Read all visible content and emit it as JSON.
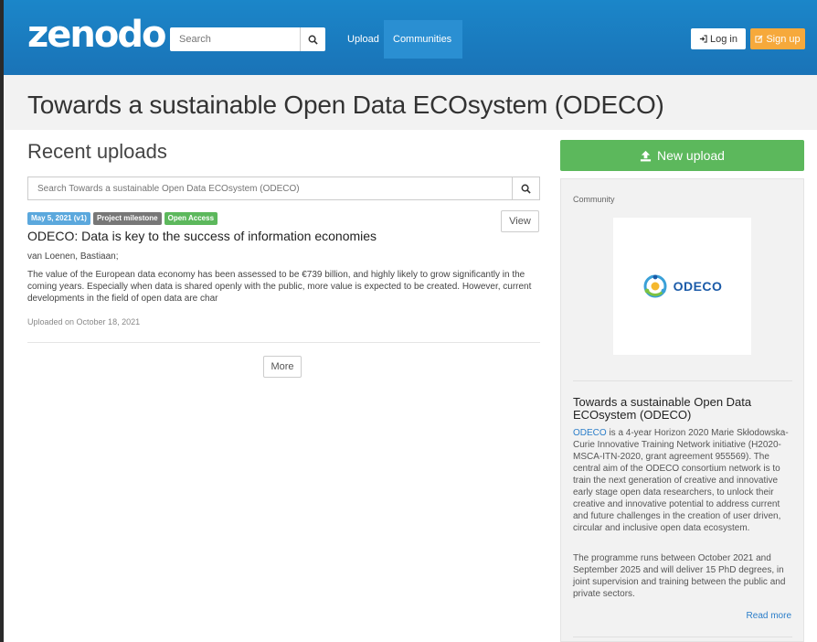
{
  "navbar": {
    "logo": "zenodo",
    "search_placeholder": "Search",
    "links": [
      "Upload",
      "Communities"
    ],
    "login_label": "Log in",
    "signup_label": "Sign up"
  },
  "page": {
    "title": "Towards a sustainable Open Data ECOsystem (ODECO)"
  },
  "uploads": {
    "heading": "Recent uploads",
    "search_placeholder": "Search Towards a sustainable Open Data ECOsystem (ODECO)",
    "records": [
      {
        "badges": [
          "May 5, 2021 (v1)",
          "Project milestone",
          "Open Access"
        ],
        "view_label": "View",
        "title": "ODECO: Data is key to the success of information economies",
        "authors": "van Loenen, Bastiaan;",
        "description": "The value of the European data economy has been assessed to be €739 billion, and highly likely to grow significantly in the coming years. Especially when data is shared openly with the public, more value is expected to be created. However, current developments in the field of open data are char",
        "uploaded": "Uploaded on October 18, 2021"
      }
    ],
    "more_label": "More"
  },
  "sidebar": {
    "new_upload_label": "New upload",
    "panel_label": "Community",
    "logo_text": "ODECO",
    "community_title": "Towards a sustainable Open Data ECOsystem (ODECO)",
    "desc_link": "ODECO",
    "desc_part1": " is a 4-year Horizon 2020 Marie Skłodowska-Curie Innovative Training Network initiative (H2020-MSCA-ITN-2020, grant agreement 955569). The central aim of the ODECO consortium network is to train the next generation of creative and innovative early stage open data researchers, to unlock their creative and innovative potential to address current and future challenges in the creation of user driven, circular and inclusive open data ecosystem.",
    "desc_part2": "The programme runs between October 2021 and September 2025 and will deliver 15 PhD degrees, in joint supervision and training between the public and private sectors.",
    "read_more": "Read more"
  },
  "colors": {
    "navbar": "#1a7cc1",
    "signup": "#f6a93b",
    "success": "#5cb85c",
    "link": "#2a7dc9"
  }
}
